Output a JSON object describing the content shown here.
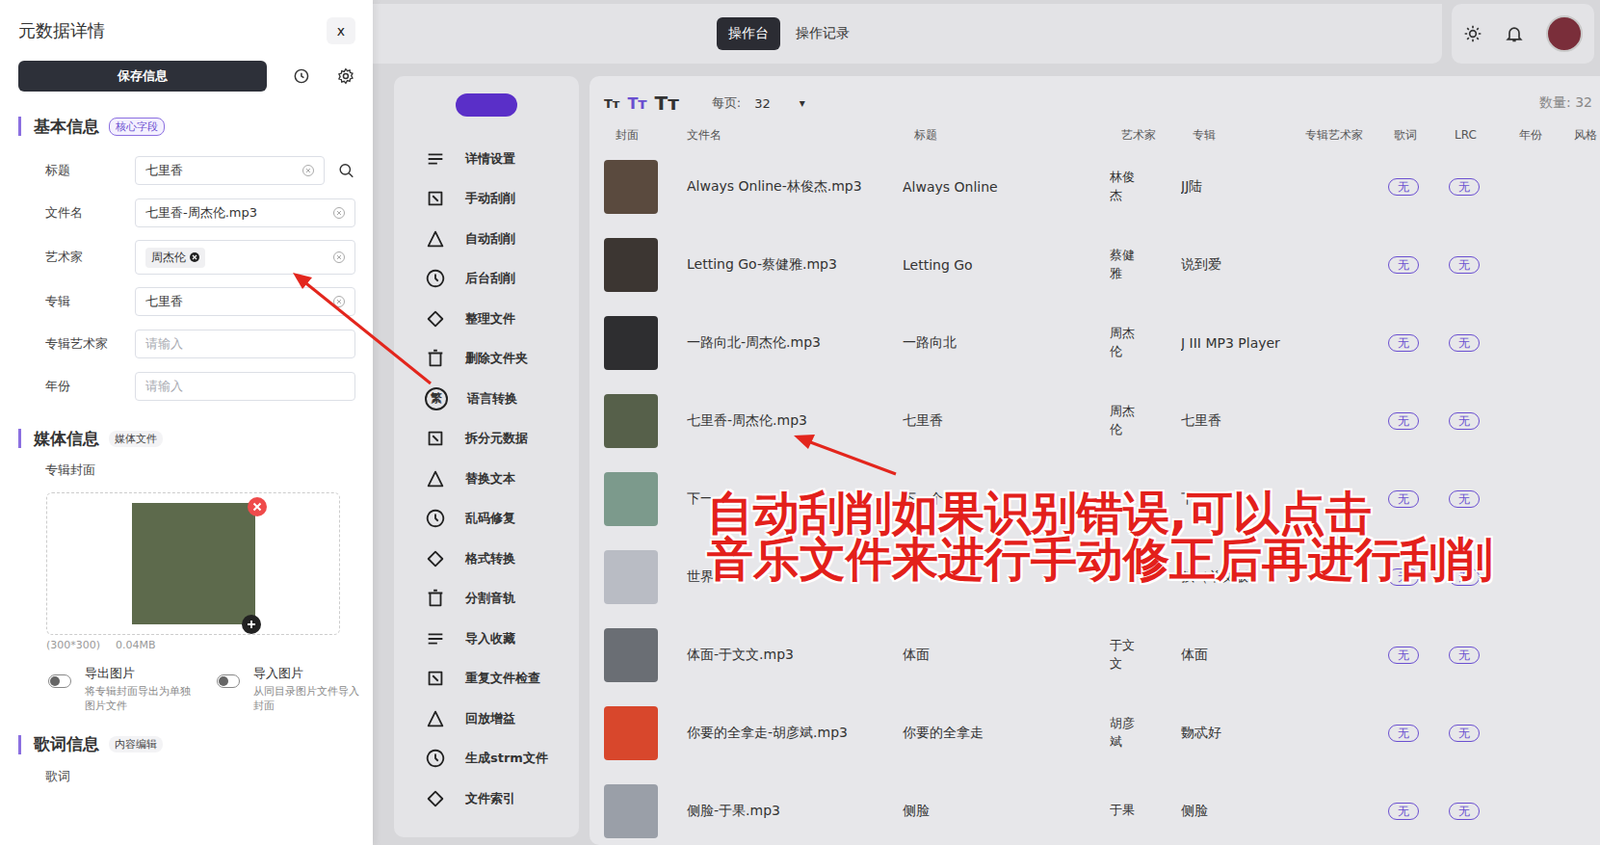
{
  "topbar": {
    "tabs": [
      {
        "label": "操作台",
        "selected": true
      },
      {
        "label": "操作记录",
        "selected": false
      }
    ]
  },
  "menu": {
    "items": [
      {
        "label": "详情设置",
        "glyph": ""
      },
      {
        "label": "手动刮削",
        "glyph": ""
      },
      {
        "label": "自动刮削",
        "glyph": ""
      },
      {
        "label": "后台刮削",
        "glyph": ""
      },
      {
        "label": "整理文件",
        "glyph": ""
      },
      {
        "label": "删除文件夹",
        "glyph": ""
      },
      {
        "label": "语言转换",
        "glyph": "繁"
      },
      {
        "label": "拆分元数据",
        "glyph": ""
      },
      {
        "label": "替换文本",
        "glyph": ""
      },
      {
        "label": "乱码修复",
        "glyph": ""
      },
      {
        "label": "格式转换",
        "glyph": ""
      },
      {
        "label": "分割音轨",
        "glyph": ""
      },
      {
        "label": "导入收藏",
        "glyph": ""
      },
      {
        "label": "重复文件检查",
        "glyph": ""
      },
      {
        "label": "回放增益",
        "glyph": ""
      },
      {
        "label": "生成strm文件",
        "glyph": ""
      },
      {
        "label": "文件索引",
        "glyph": ""
      }
    ]
  },
  "table": {
    "font_sizes": [
      {
        "label": "Tт",
        "selected": false
      },
      {
        "label": "Tт",
        "selected": true
      },
      {
        "label": "Tт",
        "selected": false
      }
    ],
    "per_page_label": "每页:",
    "per_page": "32",
    "dropdown": "▾",
    "count_label": "数量:",
    "count": "32",
    "columns": [
      "封面",
      "文件名",
      "标题",
      "艺术家",
      "专辑",
      "专辑艺术家",
      "歌词",
      "LRC",
      "年份",
      "风格"
    ],
    "rows": [
      {
        "cover_color": "#5a4a3e",
        "file": "Always Online-林俊杰.mp3",
        "title": "Always Online",
        "artist": "林俊杰",
        "album": "JJ陆",
        "lyrics": "无",
        "lrc": "无"
      },
      {
        "cover_color": "#3c3632",
        "file": "Letting Go-蔡健雅.mp3",
        "title": "Letting Go",
        "artist": "蔡健雅",
        "album": "说到爱",
        "lyrics": "无",
        "lrc": "无"
      },
      {
        "cover_color": "#2e2e30",
        "file": "一路向北-周杰伦.mp3",
        "title": "一路向北",
        "artist": "周杰伦",
        "album": "J III MP3 Player",
        "lyrics": "无",
        "lrc": "无"
      },
      {
        "cover_color": "#56604a",
        "file": "七里香-周杰伦.mp3",
        "title": "七里香",
        "artist": "周杰伦",
        "album": "七里香",
        "lyrics": "无",
        "lrc": "无"
      },
      {
        "cover_color": "#7c9a8c",
        "file": "下一",
        "title": "下一个",
        "artist": "",
        "album": "下",
        "lyrics": "无",
        "lrc": "无"
      },
      {
        "cover_color": "#b9bcc4",
        "file": "世界",
        "title": "",
        "artist": "",
        "album": "孩（单文版）",
        "lyrics": "无",
        "lrc": "无"
      },
      {
        "cover_color": "#6a6e74",
        "file": "体面-于文文.mp3",
        "title": "体面",
        "artist": "于文文",
        "album": "体面",
        "lyrics": "无",
        "lrc": "无"
      },
      {
        "cover_color": "#d8472c",
        "file": "你要的全拿走-胡彦斌.mp3",
        "title": "你要的全拿走",
        "artist": "胡彦斌",
        "album": "覅忒好",
        "lyrics": "无",
        "lrc": "无"
      },
      {
        "cover_color": "#9a9fa8",
        "file": "侧脸-于果.mp3",
        "title": "侧脸",
        "artist": "于果",
        "album": "侧脸",
        "lyrics": "无",
        "lrc": "无"
      }
    ]
  },
  "drawer": {
    "title": "元数据详情",
    "close": "x",
    "save_button": "保存信息",
    "basic": {
      "title": "基本信息",
      "tag": "核心字段",
      "fields": [
        {
          "label": "标题",
          "kind": "search",
          "value": "七里香",
          "placeholder": "",
          "tags": []
        },
        {
          "label": "文件名",
          "kind": "text",
          "value": "七里香-周杰伦.mp3",
          "placeholder": "",
          "tags": []
        },
        {
          "label": "艺术家",
          "kind": "tags",
          "value": "",
          "placeholder": "",
          "tags": [
            "周杰伦"
          ]
        },
        {
          "label": "专辑",
          "kind": "text",
          "value": "七里香",
          "placeholder": "",
          "tags": []
        },
        {
          "label": "专辑艺术家",
          "kind": "text",
          "value": "",
          "placeholder": "请输入",
          "tags": []
        },
        {
          "label": "年份",
          "kind": "text",
          "value": "",
          "placeholder": "请输入",
          "tags": []
        }
      ]
    },
    "media": {
      "title": "媒体信息",
      "tag": "媒体文件",
      "cover_label": "专辑封面",
      "cover_color": "#5d6a4c",
      "dimensions": "(300*300)",
      "size": "0.04MB",
      "toggles": [
        {
          "label": "导出图片",
          "description": "将专辑封面导出为单独图片文件",
          "on": false
        },
        {
          "label": "导入图片",
          "description": "从同目录图片文件导入封面",
          "on": false
        }
      ]
    },
    "lyrics": {
      "title": "歌词信息",
      "tag": "内容编辑",
      "field_label": "歌词"
    }
  },
  "annotation": {
    "lines": [
      "自动刮削如果识别错误,可以点击",
      "音乐文件来进行手动修正后再进行刮削"
    ]
  }
}
